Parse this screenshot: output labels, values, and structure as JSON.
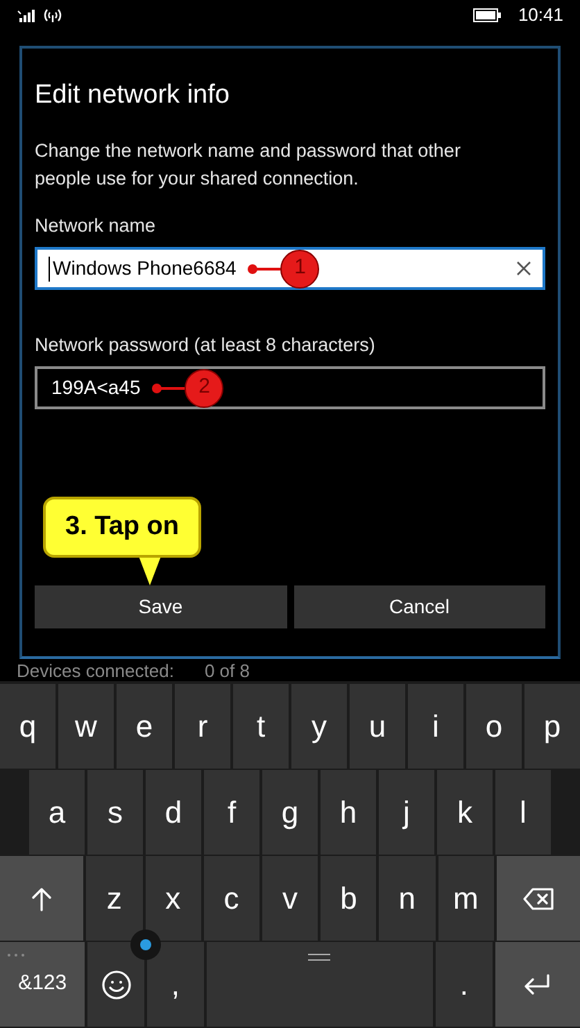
{
  "status_bar": {
    "time": "10:41"
  },
  "dialog": {
    "title": "Edit network info",
    "description": "Change the network name and password that other people use for your shared connection.",
    "fields": [
      {
        "label": "Network name",
        "value": "Windows Phone6684",
        "focused": true,
        "marker": "1"
      },
      {
        "label": "Network password (at least 8 characters)",
        "value": "199A<a45",
        "focused": false,
        "marker": "2"
      }
    ],
    "callout": "3. Tap on",
    "buttons": [
      {
        "label": "Save"
      },
      {
        "label": "Cancel"
      }
    ]
  },
  "behind": {
    "label": "Devices connected:",
    "value": "0 of 8"
  },
  "keyboard": {
    "rows": [
      {
        "keys": [
          {
            "kind": "letter",
            "label": "q"
          },
          {
            "kind": "letter",
            "label": "w"
          },
          {
            "kind": "letter",
            "label": "e"
          },
          {
            "kind": "letter",
            "label": "r"
          },
          {
            "kind": "letter",
            "label": "t"
          },
          {
            "kind": "letter",
            "label": "y"
          },
          {
            "kind": "letter",
            "label": "u"
          },
          {
            "kind": "letter",
            "label": "i"
          },
          {
            "kind": "letter",
            "label": "o"
          },
          {
            "kind": "letter",
            "label": "p"
          }
        ]
      },
      {
        "keys": [
          {
            "kind": "letter",
            "label": "a"
          },
          {
            "kind": "letter",
            "label": "s"
          },
          {
            "kind": "letter",
            "label": "d"
          },
          {
            "kind": "letter",
            "label": "f"
          },
          {
            "kind": "letter",
            "label": "g"
          },
          {
            "kind": "letter",
            "label": "h"
          },
          {
            "kind": "letter",
            "label": "j"
          },
          {
            "kind": "letter",
            "label": "k"
          },
          {
            "kind": "letter",
            "label": "l"
          }
        ]
      },
      {
        "keys": [
          {
            "kind": "shift"
          },
          {
            "kind": "letter",
            "label": "z"
          },
          {
            "kind": "letter",
            "label": "x"
          },
          {
            "kind": "letter",
            "label": "c"
          },
          {
            "kind": "letter",
            "label": "v"
          },
          {
            "kind": "letter",
            "label": "b"
          },
          {
            "kind": "letter",
            "label": "n"
          },
          {
            "kind": "letter",
            "label": "m"
          },
          {
            "kind": "backspace"
          }
        ]
      },
      {
        "keys": [
          {
            "kind": "symbols",
            "label": "&123"
          },
          {
            "kind": "emoji"
          },
          {
            "kind": "letter",
            "label": ","
          },
          {
            "kind": "space"
          },
          {
            "kind": "letter",
            "label": "."
          },
          {
            "kind": "enter"
          }
        ]
      }
    ]
  }
}
